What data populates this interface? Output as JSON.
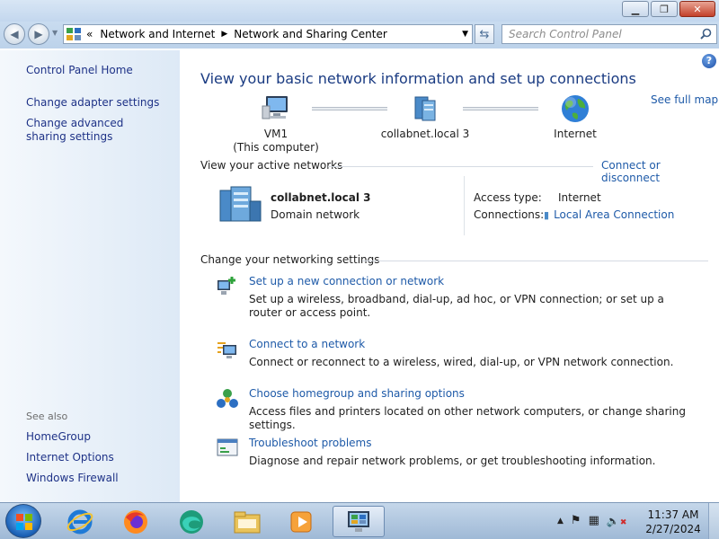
{
  "address": {
    "crumbs": [
      "Network and Internet",
      "Network and Sharing Center"
    ],
    "overflow_glyph": "«"
  },
  "search": {
    "placeholder": "Search Control Panel"
  },
  "sidebar": {
    "home": "Control Panel Home",
    "links": [
      "Change adapter settings",
      "Change advanced sharing settings"
    ],
    "see_also_label": "See also",
    "see_also": [
      "HomeGroup",
      "Internet Options",
      "Windows Firewall"
    ]
  },
  "main": {
    "title": "View your basic network information and set up connections",
    "see_full_map": "See full map",
    "map": {
      "computer_name": "VM1",
      "computer_sub": "(This computer)",
      "network": "collabnet.local  3",
      "internet": "Internet"
    },
    "active_header": "View your active networks",
    "connect_link": "Connect or disconnect",
    "active_network": {
      "name": "collabnet.local  3",
      "type": "Domain network",
      "access_label": "Access type:",
      "access_value": "Internet",
      "connections_label": "Connections:",
      "connections_value": "Local Area Connection"
    },
    "settings_header": "Change your networking settings",
    "tasks": [
      {
        "icon": "new-connection-icon",
        "link": "Set up a new connection or network",
        "desc": "Set up a wireless, broadband, dial-up, ad hoc, or VPN connection; or set up a router or access point."
      },
      {
        "icon": "connect-network-icon",
        "link": "Connect to a network",
        "desc": "Connect or reconnect to a wireless, wired, dial-up, or VPN network connection."
      },
      {
        "icon": "homegroup-icon",
        "link": "Choose homegroup and sharing options",
        "desc": "Access files and printers located on other network computers, or change sharing settings."
      },
      {
        "icon": "troubleshoot-icon",
        "link": "Troubleshoot problems",
        "desc": "Diagnose and repair network problems, or get troubleshooting information."
      }
    ]
  },
  "taskbar": {
    "time": "11:37 AM",
    "date": "2/27/2024",
    "apps": [
      "internet-explorer-icon",
      "firefox-icon",
      "edge-icon",
      "file-explorer-icon",
      "media-player-icon",
      "control-panel-icon"
    ]
  },
  "colors": {
    "link": "#1e5aa8",
    "title": "#1a3b82",
    "sidebar_link": "#1e3287"
  }
}
